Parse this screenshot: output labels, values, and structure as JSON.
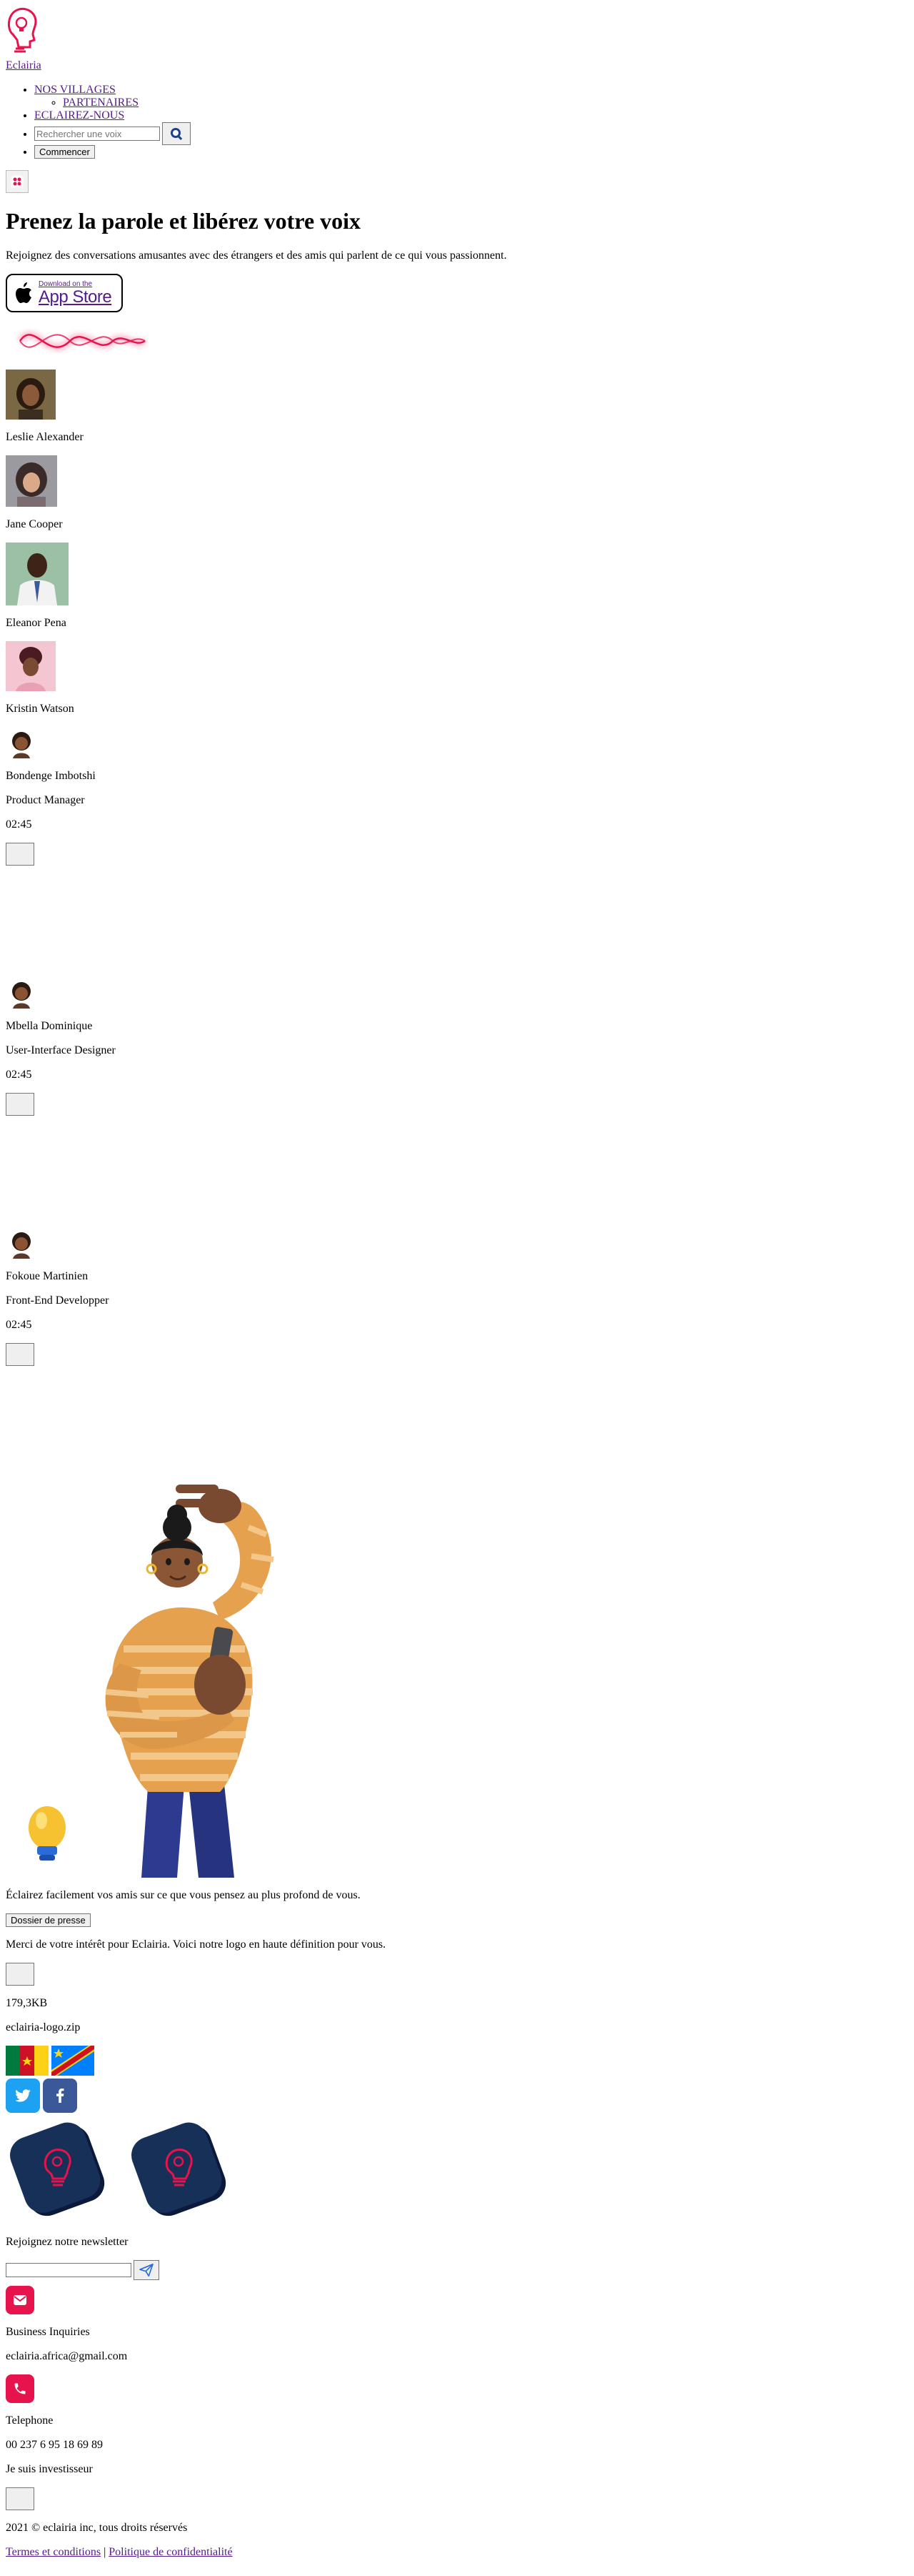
{
  "brand": {
    "name": "Eclairia",
    "accent": "#e7134d"
  },
  "nav": {
    "items": [
      {
        "label": "NOS VILLAGES"
      },
      {
        "label": "ECLAIREZ-NOUS"
      }
    ],
    "sub_items": [
      {
        "label": "PARTENAIRES"
      }
    ],
    "search_placeholder": "Rechercher une voix",
    "start_label": "Commencer"
  },
  "hero": {
    "title": "Prenez la parole et libérez votre voix",
    "subtitle": "Rejoignez des conversations amusantes avec des étrangers et des amis qui parlent de ce qui vous passionnent.",
    "appstore_line1": "Download on the",
    "appstore_line2": "App Store"
  },
  "people": [
    {
      "name": "Leslie Alexander"
    },
    {
      "name": "Jane Cooper"
    },
    {
      "name": "Eleanor Pena"
    },
    {
      "name": "Kristin Watson"
    }
  ],
  "speakers": [
    {
      "name": "Bondenge Imbotshi",
      "role": "Product Manager",
      "duration": "02:45"
    },
    {
      "name": "Mbella Dominique",
      "role": "User-Interface Designer",
      "duration": "02:45"
    },
    {
      "name": "Fokoue Martinien",
      "role": "Front-End Developper",
      "duration": "02:45"
    }
  ],
  "promo": {
    "text": "Éclairez facilement vos amis sur ce que vous pensez au plus profond de vous."
  },
  "press": {
    "button_label": "Dossier de presse",
    "text": "Merci de votre intérêt pour Eclairia. Voici notre logo en haute définition pour vous.",
    "file_size": "179,3KB",
    "file_name": "eclairia-logo.zip"
  },
  "footer": {
    "newsletter_label": "Rejoignez notre newsletter",
    "business_label": "Business Inquiries",
    "business_email": "eclairia.africa@gmail.com",
    "phone_label": "Telephone",
    "phone_number": "00 237 6 95 18 69 89",
    "investor_label": "Je suis investisseur",
    "copyright": "2021 © eclairia inc, tous droits réservés",
    "terms_label": "Termes et conditions",
    "separator": "|",
    "privacy_label": "Politique de confidentialité"
  },
  "icons": {
    "logo": "head-bulb-icon",
    "search": "search-icon",
    "grid": "grid-icon",
    "apple": "apple-icon",
    "send": "paper-plane-icon",
    "mail": "mail-icon",
    "phone": "phone-icon",
    "twitter": "twitter-icon",
    "facebook": "facebook-icon"
  }
}
